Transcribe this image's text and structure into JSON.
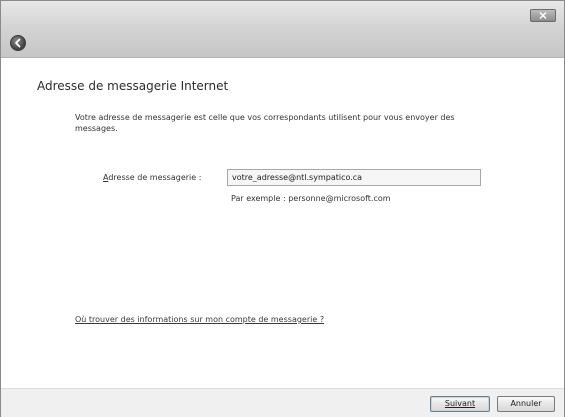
{
  "window": {
    "icons": {
      "back": "back-arrow-icon",
      "close": "close-icon"
    }
  },
  "page": {
    "title": "Adresse de messagerie Internet",
    "description": "Votre adresse de messagerie est celle que vos correspondants utilisent pour vous envoyer des messages."
  },
  "form": {
    "email_label": "Adresse de messagerie :",
    "email_value": "votre_adresse@ntl.sympatico.ca",
    "example_text": "Par exemple : personne@microsoft.com"
  },
  "help_link": "Où trouver des informations sur mon compte de messagerie ?",
  "buttons": {
    "next": "Suivant",
    "cancel": "Annuler"
  }
}
